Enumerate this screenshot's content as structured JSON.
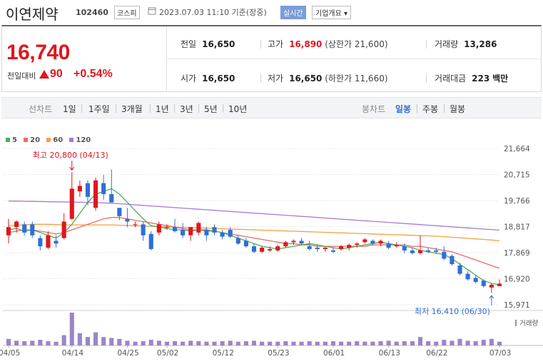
{
  "header": {
    "name": "이연제약",
    "code": "102460",
    "market": "코스피",
    "date": "2023.07.03 11:10 기준(장중)",
    "realtime_label": "실시간",
    "company_info_label": "기업개요 ▾"
  },
  "quote": {
    "price": "16,740",
    "change_label": "전일대비",
    "change": "90",
    "change_pct": "+0.54%",
    "prev_close_label": "전일",
    "prev_close": "16,650",
    "high_label": "고가",
    "high": "16,890",
    "upper_limit": "(상한가 21,600)",
    "volume_label": "거래량",
    "volume": "13,286",
    "open_label": "시가",
    "open": "16,650",
    "low_label": "저가",
    "low": "16,650",
    "lower_limit": "(하한가 11,660)",
    "value_label": "거래대금",
    "value": "223",
    "value_unit": "백만"
  },
  "periods": {
    "line_chart": "선차트",
    "items": [
      "1일",
      "1주일",
      "3개월",
      "1년",
      "3년",
      "5년",
      "10년"
    ],
    "candle_chart": "봉차트",
    "candle_items": [
      "일봉",
      "주봉",
      "월봉"
    ],
    "selected_candle": "일봉"
  },
  "colors": {
    "up": "#e0161e",
    "down": "#2e6fd8",
    "ma5": "#4caf50",
    "ma20": "#f06a6a",
    "ma60": "#f5a142",
    "ma120": "#a57ad6"
  },
  "chart_data": {
    "type": "candlestick",
    "legend": [
      "5",
      "20",
      "60",
      "120"
    ],
    "y_ticks": [
      "21,664",
      "20,715",
      "19,766",
      "18,817",
      "17,869",
      "16,920",
      "15,971"
    ],
    "y_tick_values": [
      21664,
      20715,
      19766,
      18817,
      17869,
      16920,
      15971
    ],
    "ylim": [
      15971,
      21664
    ],
    "x_ticks": [
      "04/05",
      "04/14",
      "04/25",
      "05/02",
      "05/12",
      "05/23",
      "06/01",
      "06/13",
      "06/22",
      "07/03"
    ],
    "high_annotation": "최고 20,800 (04/13)",
    "low_annotation": "최저 16,410 (06/30)",
    "volume_label": "거래량",
    "candles": [
      {
        "o": 18500,
        "h": 19100,
        "l": 18200,
        "c": 18800
      },
      {
        "o": 18800,
        "h": 19050,
        "l": 18600,
        "c": 19000
      },
      {
        "o": 18900,
        "h": 19000,
        "l": 18500,
        "c": 18600
      },
      {
        "o": 18900,
        "h": 19000,
        "l": 18400,
        "c": 18500
      },
      {
        "o": 18400,
        "h": 18500,
        "l": 17950,
        "c": 18100
      },
      {
        "o": 18050,
        "h": 18650,
        "l": 18000,
        "c": 18500
      },
      {
        "o": 18300,
        "h": 18500,
        "l": 18050,
        "c": 18200
      },
      {
        "o": 18400,
        "h": 19300,
        "l": 18350,
        "c": 19000
      },
      {
        "o": 19100,
        "h": 20800,
        "l": 19050,
        "c": 20200
      },
      {
        "o": 20100,
        "h": 20500,
        "l": 19900,
        "c": 20300
      },
      {
        "o": 20400,
        "h": 20500,
        "l": 19600,
        "c": 19900
      },
      {
        "o": 19500,
        "h": 20600,
        "l": 19400,
        "c": 20500
      },
      {
        "o": 20400,
        "h": 20700,
        "l": 19800,
        "c": 20000
      },
      {
        "o": 20000,
        "h": 20900,
        "l": 19800,
        "c": 19700
      },
      {
        "o": 19500,
        "h": 19500,
        "l": 19050,
        "c": 19200
      },
      {
        "o": 19100,
        "h": 19500,
        "l": 18800,
        "c": 19000
      },
      {
        "o": 18900,
        "h": 19000,
        "l": 18800,
        "c": 18900
      },
      {
        "o": 18900,
        "h": 19000,
        "l": 18300,
        "c": 18500
      },
      {
        "o": 18550,
        "h": 18650,
        "l": 17950,
        "c": 18000
      },
      {
        "o": 18600,
        "h": 19000,
        "l": 18500,
        "c": 18900
      },
      {
        "o": 18800,
        "h": 18900,
        "l": 18700,
        "c": 18800
      },
      {
        "o": 18800,
        "h": 19100,
        "l": 18600,
        "c": 18650
      },
      {
        "o": 18700,
        "h": 18950,
        "l": 18400,
        "c": 18500
      },
      {
        "o": 18500,
        "h": 18800,
        "l": 18300,
        "c": 18800
      },
      {
        "o": 18600,
        "h": 19000,
        "l": 18500,
        "c": 18950
      },
      {
        "o": 18700,
        "h": 18800,
        "l": 18300,
        "c": 18500
      },
      {
        "o": 18800,
        "h": 18900,
        "l": 18500,
        "c": 18600
      },
      {
        "o": 18600,
        "h": 18700,
        "l": 18350,
        "c": 18450
      },
      {
        "o": 18700,
        "h": 18800,
        "l": 18400,
        "c": 18450
      },
      {
        "o": 18400,
        "h": 18500,
        "l": 18150,
        "c": 18200
      },
      {
        "o": 18300,
        "h": 18400,
        "l": 18050,
        "c": 18100
      },
      {
        "o": 18100,
        "h": 18200,
        "l": 17850,
        "c": 17900
      },
      {
        "o": 17900,
        "h": 18100,
        "l": 17850,
        "c": 18050
      },
      {
        "o": 17950,
        "h": 18100,
        "l": 17900,
        "c": 18000
      },
      {
        "o": 17950,
        "h": 18150,
        "l": 17900,
        "c": 18100
      },
      {
        "o": 18100,
        "h": 18300,
        "l": 18050,
        "c": 18250
      },
      {
        "o": 18250,
        "h": 18350,
        "l": 18150,
        "c": 18300
      },
      {
        "o": 18300,
        "h": 18400,
        "l": 18150,
        "c": 18200
      },
      {
        "o": 18100,
        "h": 18300,
        "l": 17950,
        "c": 18000
      },
      {
        "o": 18050,
        "h": 18150,
        "l": 17900,
        "c": 18000
      },
      {
        "o": 18000,
        "h": 18100,
        "l": 17900,
        "c": 18050
      },
      {
        "o": 17950,
        "h": 18050,
        "l": 17850,
        "c": 17900
      },
      {
        "o": 18000,
        "h": 18150,
        "l": 17950,
        "c": 18100
      },
      {
        "o": 18050,
        "h": 18200,
        "l": 17950,
        "c": 18150
      },
      {
        "o": 18150,
        "h": 18250,
        "l": 18050,
        "c": 18200
      },
      {
        "o": 18250,
        "h": 18400,
        "l": 18200,
        "c": 18350
      },
      {
        "o": 18300,
        "h": 18350,
        "l": 18150,
        "c": 18200
      },
      {
        "o": 18200,
        "h": 18350,
        "l": 18100,
        "c": 18300
      },
      {
        "o": 18200,
        "h": 18300,
        "l": 18000,
        "c": 18050
      },
      {
        "o": 18100,
        "h": 18250,
        "l": 18050,
        "c": 18150
      },
      {
        "o": 18100,
        "h": 18200,
        "l": 17850,
        "c": 17950
      },
      {
        "o": 17950,
        "h": 18050,
        "l": 17800,
        "c": 17850
      },
      {
        "o": 17850,
        "h": 18500,
        "l": 17800,
        "c": 17950
      },
      {
        "o": 17950,
        "h": 18050,
        "l": 17850,
        "c": 17900
      },
      {
        "o": 17950,
        "h": 18050,
        "l": 17850,
        "c": 17900
      },
      {
        "o": 17900,
        "h": 18100,
        "l": 17600,
        "c": 17650
      },
      {
        "o": 17750,
        "h": 17800,
        "l": 17400,
        "c": 17450
      },
      {
        "o": 17400,
        "h": 17500,
        "l": 17050,
        "c": 17100
      },
      {
        "o": 17100,
        "h": 17200,
        "l": 16850,
        "c": 16900
      },
      {
        "o": 16950,
        "h": 17050,
        "l": 16750,
        "c": 16800
      },
      {
        "o": 16850,
        "h": 16900,
        "l": 16600,
        "c": 16650
      },
      {
        "o": 16600,
        "h": 16750,
        "l": 16410,
        "c": 16700
      },
      {
        "o": 16650,
        "h": 16890,
        "l": 16650,
        "c": 16740
      }
    ],
    "ma5": [
      18700,
      18750,
      18650,
      18700,
      18600,
      18500,
      18400,
      18600,
      18900,
      19300,
      19700,
      20000,
      20100,
      20200,
      20000,
      19700,
      19400,
      19100,
      18850,
      18800,
      18750,
      18700,
      18700,
      18650,
      18700,
      18700,
      18650,
      18600,
      18500,
      18400,
      18300,
      18200,
      18100,
      18050,
      18000,
      18050,
      18100,
      18150,
      18200,
      18150,
      18100,
      18050,
      18000,
      18050,
      18100,
      18150,
      18200,
      18250,
      18200,
      18150,
      18100,
      18050,
      17950,
      17900,
      17850,
      17800,
      17650,
      17450,
      17250,
      17050,
      16850,
      16750,
      16700
    ],
    "ma20": [
      18600,
      18650,
      18700,
      18700,
      18650,
      18600,
      18550,
      18600,
      18700,
      18800,
      18900,
      19000,
      19100,
      19150,
      19150,
      19100,
      19050,
      19000,
      18950,
      18900,
      18850,
      18800,
      18750,
      18700,
      18700,
      18650,
      18650,
      18600,
      18550,
      18500,
      18450,
      18400,
      18350,
      18300,
      18250,
      18200,
      18200,
      18150,
      18150,
      18100,
      18100,
      18100,
      18100,
      18100,
      18100,
      18100,
      18150,
      18150,
      18150,
      18150,
      18150,
      18100,
      18100,
      18050,
      18000,
      17950,
      17900,
      17800,
      17700,
      17600,
      17500,
      17400,
      17300
    ],
    "ma60": [
      18850,
      18870,
      18880,
      18900,
      18900,
      18900,
      18890,
      18880,
      18880,
      18880,
      18880,
      18880,
      18880,
      18880,
      18870,
      18860,
      18850,
      18840,
      18830,
      18820,
      18810,
      18800,
      18790,
      18780,
      18770,
      18760,
      18750,
      18740,
      18730,
      18720,
      18710,
      18700,
      18690,
      18680,
      18670,
      18660,
      18650,
      18640,
      18630,
      18620,
      18610,
      18600,
      18590,
      18580,
      18570,
      18560,
      18550,
      18540,
      18530,
      18520,
      18510,
      18500,
      18490,
      18480,
      18470,
      18450,
      18430,
      18410,
      18390,
      18370,
      18350,
      18330,
      18300
    ],
    "ma120": [
      19750,
      19745,
      19740,
      19735,
      19730,
      19725,
      19720,
      19715,
      19710,
      19705,
      19700,
      19690,
      19680,
      19670,
      19650,
      19630,
      19610,
      19590,
      19570,
      19550,
      19530,
      19510,
      19490,
      19470,
      19450,
      19430,
      19410,
      19390,
      19370,
      19350,
      19330,
      19310,
      19290,
      19270,
      19250,
      19230,
      19210,
      19190,
      19170,
      19150,
      19130,
      19110,
      19090,
      19070,
      19050,
      19030,
      19010,
      18990,
      18970,
      18950,
      18930,
      18910,
      18890,
      18870,
      18850,
      18830,
      18810,
      18790,
      18770,
      18750,
      18730,
      18710,
      18690
    ],
    "volume": [
      14,
      10,
      9,
      10,
      12,
      9,
      8,
      22,
      70,
      26,
      18,
      28,
      18,
      16,
      14,
      10,
      8,
      9,
      12,
      10,
      8,
      9,
      8,
      10,
      9,
      8,
      8,
      9,
      10,
      8,
      9,
      10,
      8,
      8,
      8,
      9,
      8,
      8,
      9,
      8,
      8,
      9,
      8,
      8,
      9,
      8,
      8,
      9,
      10,
      8,
      9,
      9,
      18,
      9,
      8,
      12,
      10,
      14,
      10,
      9,
      12,
      14,
      8
    ]
  }
}
